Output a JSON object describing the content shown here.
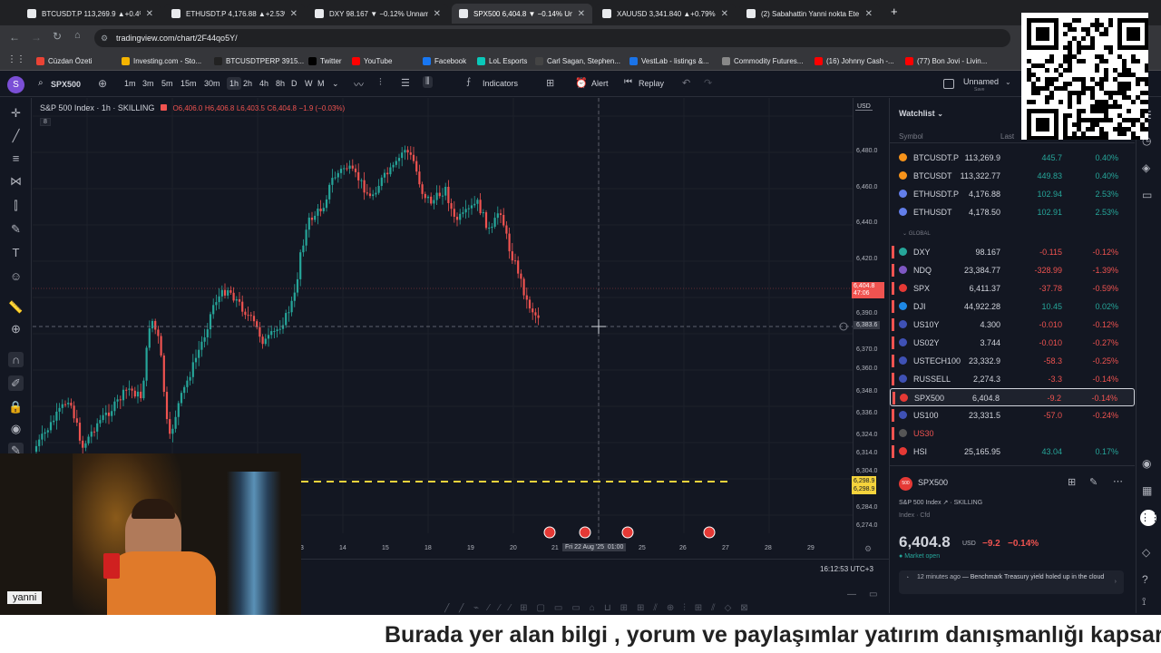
{
  "browser": {
    "tabs": [
      {
        "label": "BTCUSDT.P 113,269.9 ▲+0.4%",
        "active": false
      },
      {
        "label": "ETHUSDT.P 4,176.88 ▲+2.53%",
        "active": false
      },
      {
        "label": "DXY 98.167 ▼ −0.12% Unnamed",
        "active": false
      },
      {
        "label": "SPX500 6,404.8 ▼ −0.14% Unnamed",
        "active": true
      },
      {
        "label": "XAUUSD 3,341.840 ▲+0.79% Unnamed",
        "active": false
      },
      {
        "label": "(2) Sabahattin Yanni nokta Ete...",
        "active": false
      }
    ],
    "new_tab": "+",
    "url": "tradingview.com/chart/2F44qo5Y/",
    "bookmarks": [
      "Cüzdan Özeti",
      "Investing.com - Sto...",
      "BTCUSDTPERP 3915...",
      "Twitter",
      "YouTube",
      "Facebook",
      "LoL Esports",
      "Carl Sagan, Stephen...",
      "VestLab - listings &...",
      "Commodity Futures...",
      "(16) Johnny Cash -...",
      "(77) Bon Jovi - Livin..."
    ]
  },
  "toolbar": {
    "avatar": "S",
    "symbol": "SPX500",
    "intervals": [
      "1m",
      "3m",
      "5m",
      "15m",
      "30m",
      "1h",
      "2h",
      "4h",
      "8h",
      "D",
      "W",
      "M"
    ],
    "active_interval": "1h",
    "indicators": "Indicators",
    "alert": "Alert",
    "replay": "Replay",
    "layout_name": "Unnamed",
    "layout_sub": "Save"
  },
  "chart": {
    "legend_symbol": "S&P 500 Index · 1h · SKILLING",
    "legend_o": "O6,406.0",
    "legend_h": "H6,406.8",
    "legend_l": "L6,403.5",
    "legend_c": "C6,404.8",
    "legend_chg": "−1.9 (−0.03%)",
    "legend_badge": "8",
    "currency": "USD",
    "price_labels": [
      "6,480.0",
      "6,460.0",
      "6,440.0",
      "6,420.0",
      "6,390.0",
      "6,370.0",
      "6,360.0",
      "6,348.0",
      "6,336.0",
      "6,324.0",
      "6,314.0",
      "6,304.0",
      "6,284.0",
      "6,274.0"
    ],
    "current_price": "6,404.8",
    "countdown": "47:06",
    "crosshair_price": "6,383.6",
    "alert_line_price_1": "6,298.9",
    "alert_line_price_2": "6,298.9",
    "time_labels": [
      "3",
      "14",
      "15",
      "18",
      "19",
      "20",
      "21",
      "25",
      "26",
      "27",
      "28",
      "29"
    ],
    "crosshair_date": "Fri 22 Aug '25",
    "crosshair_time": "01:00",
    "clock": "16:12:53 UTC+3",
    "colors": {
      "up": "#26a69a",
      "down": "#ef5350",
      "bg": "#131722"
    }
  },
  "watchlist": {
    "title": "Watchlist",
    "col_symbol": "Symbol",
    "col_last": "Last",
    "crypto": [
      {
        "sym": "BTCUSDT.P",
        "last": "113,269.9",
        "chg": "445.7",
        "pct": "0.40%",
        "color": "#f7931a",
        "up": true
      },
      {
        "sym": "BTCUSDT",
        "last": "113,322.77",
        "chg": "449.83",
        "pct": "0.40%",
        "color": "#f7931a",
        "up": true
      },
      {
        "sym": "ETHUSDT.P",
        "last": "4,176.88",
        "chg": "102.94",
        "pct": "2.53%",
        "color": "#627eea",
        "up": true
      },
      {
        "sym": "ETHUSDT",
        "last": "4,178.50",
        "chg": "102.91",
        "pct": "2.53%",
        "color": "#627eea",
        "up": true
      }
    ],
    "section": "GLOBAL",
    "global": [
      {
        "sym": "DXY",
        "last": "98.167",
        "chg": "-0.115",
        "pct": "-0.12%",
        "color": "#26a69a",
        "up": false
      },
      {
        "sym": "NDQ",
        "last": "23,384.77",
        "chg": "-328.99",
        "pct": "-1.39%",
        "color": "#7e57c2",
        "up": false
      },
      {
        "sym": "SPX",
        "last": "6,411.37",
        "chg": "-37.78",
        "pct": "-0.59%",
        "color": "#e53935",
        "up": false
      },
      {
        "sym": "DJI",
        "last": "44,922.28",
        "chg": "10.45",
        "pct": "0.02%",
        "color": "#1e88e5",
        "up": true
      },
      {
        "sym": "US10Y",
        "last": "4.300",
        "chg": "-0.010",
        "pct": "-0.12%",
        "color": "#3f51b5",
        "up": false
      },
      {
        "sym": "US02Y",
        "last": "3.744",
        "chg": "-0.010",
        "pct": "-0.27%",
        "color": "#3f51b5",
        "up": false
      },
      {
        "sym": "USTECH100",
        "last": "23,332.9",
        "chg": "-58.3",
        "pct": "-0.25%",
        "color": "#3f51b5",
        "up": false
      },
      {
        "sym": "RUSSELL",
        "last": "2,274.3",
        "chg": "-3.3",
        "pct": "-0.14%",
        "color": "#3f51b5",
        "up": false
      },
      {
        "sym": "SPX500",
        "last": "6,404.8",
        "chg": "-9.2",
        "pct": "-0.14%",
        "color": "#e53935",
        "up": false,
        "selected": true
      },
      {
        "sym": "US100",
        "last": "23,331.5",
        "chg": "-57.0",
        "pct": "-0.24%",
        "color": "#3f51b5",
        "up": false
      },
      {
        "sym": "US30",
        "last": "",
        "chg": "",
        "pct": "",
        "color": "#555",
        "up": false
      },
      {
        "sym": "HSI",
        "last": "25,165.95",
        "chg": "43.04",
        "pct": "0.17%",
        "color": "#e53935",
        "up": true
      }
    ]
  },
  "details": {
    "symbol": "SPX500",
    "name": "S&P 500 Index",
    "exchange": "SKILLING",
    "type": "Index · Cfd",
    "price": "6,404.8",
    "currency": "USD",
    "change": "−9.2",
    "change_pct": "−0.14%",
    "status": "Market open",
    "news_time": "12 minutes ago",
    "news_text": "Benchmark Treasury yield holed up in the cloud"
  },
  "overlay": {
    "streamer_name": "yanni",
    "subtitle": "Burada yer alan bilgi , yorum ve paylaşımlar yatırım danışmanlığı kapsar"
  }
}
